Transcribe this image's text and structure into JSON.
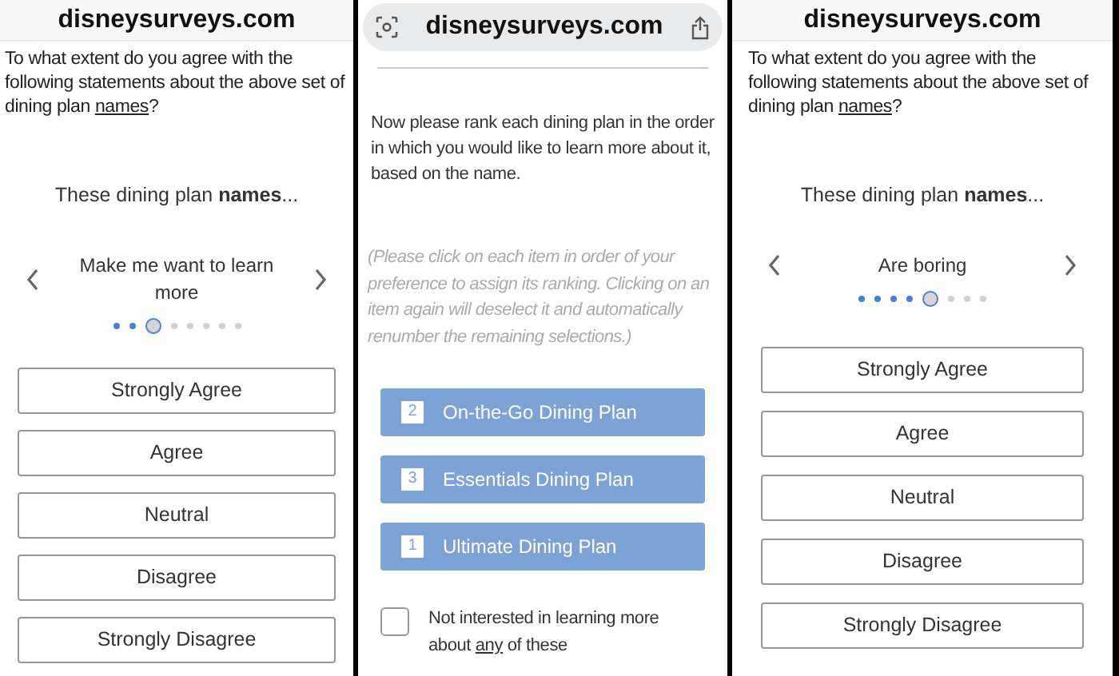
{
  "panels": [
    {
      "kind": "agree",
      "address": "disneysurveys.com",
      "question": {
        "before": "To what extent do you agree with the following statements about the above set of dining plan ",
        "underlined": "names",
        "after": "?"
      },
      "lead": "These dining plan **names**...",
      "statement": "Make me want to learn more",
      "dots": [
        {
          "visited": true,
          "selected": false
        },
        {
          "visited": true,
          "selected": false
        },
        {
          "visited": false,
          "selected": true
        },
        {
          "visited": false,
          "selected": false
        },
        {
          "visited": false,
          "selected": false
        },
        {
          "visited": false,
          "selected": false
        },
        {
          "visited": false,
          "selected": false
        },
        {
          "visited": false,
          "selected": false
        }
      ],
      "options": [
        "Strongly Agree",
        "Agree",
        "Neutral",
        "Disagree",
        "Strongly Disagree"
      ]
    },
    {
      "kind": "rank",
      "address": "disneysurveys.com",
      "instruction": "Now please rank each dining plan in the order in which you would like to learn more about it, based on the name.",
      "hint": "(Please click on each item in order of your preference to assign its ranking. Clicking on an item again will deselect it and automatically renumber the remaining selections.)",
      "plans": [
        {
          "rank": "2",
          "label": "On-the-Go Dining Plan"
        },
        {
          "rank": "3",
          "label": "Essentials Dining Plan"
        },
        {
          "rank": "1",
          "label": "Ultimate Dining Plan"
        }
      ],
      "opt_out": {
        "before": "Not interested in learning more about ",
        "underlined": "any",
        "after": " of these",
        "checked": false
      }
    },
    {
      "kind": "agree",
      "address": "disneysurveys.com",
      "question": {
        "before": "To what extent do you agree with the following statements about the above set of dining plan ",
        "underlined": "names",
        "after": "?"
      },
      "lead": "These dining plan **names**...",
      "statement": "Are boring",
      "dots": [
        {
          "visited": true,
          "selected": false
        },
        {
          "visited": true,
          "selected": false
        },
        {
          "visited": true,
          "selected": false
        },
        {
          "visited": true,
          "selected": false
        },
        {
          "visited": false,
          "selected": true
        },
        {
          "visited": false,
          "selected": false
        },
        {
          "visited": false,
          "selected": false
        },
        {
          "visited": false,
          "selected": false
        }
      ],
      "options": [
        "Strongly Agree",
        "Agree",
        "Neutral",
        "Disagree",
        "Strongly Disagree"
      ]
    }
  ]
}
